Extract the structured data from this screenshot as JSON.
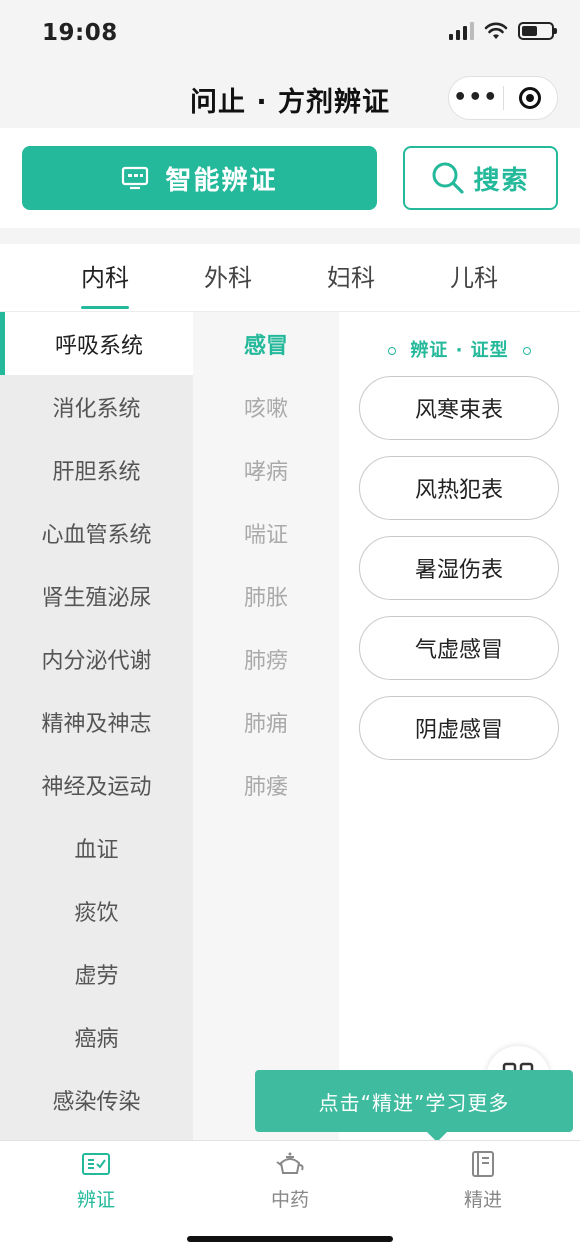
{
  "status_bar": {
    "time": "19:08",
    "battery_level": 0.55
  },
  "nav": {
    "title": "问止 · 方剂辨证",
    "more_icon": "more-dots-icon",
    "close_icon": "target-close-icon"
  },
  "actions": {
    "smart_label": "智能辨证",
    "search_label": "搜索",
    "accent": "#25b99b"
  },
  "departments": [
    {
      "label": "内科",
      "active": true
    },
    {
      "label": "外科",
      "active": false
    },
    {
      "label": "妇科",
      "active": false
    },
    {
      "label": "儿科",
      "active": false
    }
  ],
  "systems": [
    "呼吸系统",
    "消化系统",
    "肝胆系统",
    "心血管系统",
    "肾生殖泌尿",
    "内分泌代谢",
    "精神及神志",
    "神经及运动",
    "血证",
    "痰饮",
    "虚劳",
    "癌病",
    "感染传染"
  ],
  "diseases": [
    "感冒",
    "咳嗽",
    "哮病",
    "喘证",
    "肺胀",
    "肺痨",
    "肺痈",
    "肺痿"
  ],
  "syndrome_header": "辨证 · 证型",
  "syndromes": [
    "风寒束表",
    "风热犯表",
    "暑湿伤表",
    "气虚感冒",
    "阴虚感冒"
  ],
  "tooltip": "点击“精进”学习更多",
  "tabbar": [
    {
      "label": "辨证",
      "icon": "diagnosis-icon",
      "active": true
    },
    {
      "label": "中药",
      "icon": "teapot-icon",
      "active": false
    },
    {
      "label": "精进",
      "icon": "book-icon",
      "active": false
    }
  ]
}
